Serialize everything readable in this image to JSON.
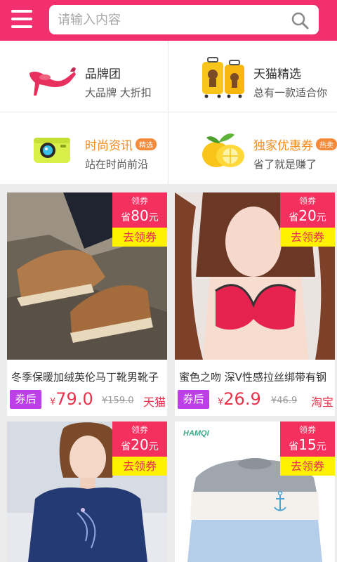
{
  "search": {
    "placeholder": "请输入内容"
  },
  "categories": [
    {
      "title": "品牌团",
      "subtitle": "大品牌 大折扣",
      "icon": "high-heel-shoe-icon"
    },
    {
      "title": "天猫精选",
      "subtitle": "总有一款适合你",
      "icon": "suitcase-icon"
    },
    {
      "title": "时尚资讯",
      "badge": "精选",
      "subtitle": "站在时尚前沿",
      "icon": "camera-icon"
    },
    {
      "title": "独家优惠券",
      "badge": "热卖",
      "subtitle": "省了就是赚了",
      "icon": "lemon-icon"
    }
  ],
  "products": [
    {
      "title": "冬季保暖加绒英伦马丁靴男靴子",
      "coupon_label": "领券",
      "coupon_prefix": "省",
      "coupon_amount": "80",
      "coupon_suffix": "元",
      "coupon_button": "去领券",
      "tag": "券后",
      "currency": "¥",
      "price": "79.0",
      "old_price": "¥159.0",
      "platform": "天猫"
    },
    {
      "title": "蜜色之吻 深V性感拉丝绑带有钢",
      "coupon_label": "领券",
      "coupon_prefix": "省",
      "coupon_amount": "20",
      "coupon_suffix": "元",
      "coupon_button": "去领券",
      "tag": "券后",
      "currency": "¥",
      "price": "26.9",
      "old_price": "¥46.9",
      "platform": "淘宝"
    },
    {
      "coupon_label": "领券",
      "coupon_prefix": "省",
      "coupon_amount": "20",
      "coupon_suffix": "元",
      "coupon_button": "去领券"
    },
    {
      "brand_logo": "HAMQI",
      "coupon_label": "领券",
      "coupon_prefix": "省",
      "coupon_amount": "15",
      "coupon_suffix": "元",
      "coupon_button": "去领券"
    }
  ],
  "colors": {
    "header": "#f3306f",
    "coupon_red": "#f5305e",
    "coupon_yellow": "#fff200",
    "price_red": "#e9314b",
    "tag_purple": "#bc3fe8",
    "orange": "#f38a1b"
  }
}
